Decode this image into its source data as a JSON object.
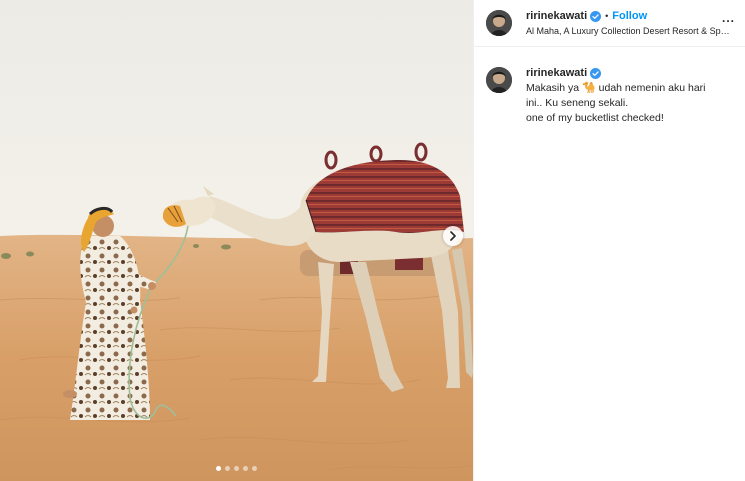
{
  "header": {
    "username": "ririnekawati",
    "separator": "•",
    "follow_label": "Follow",
    "location": "Al Maha, A Luxury Collection Desert Resort & Spa, Dubai",
    "more_label": "..."
  },
  "caption": {
    "username": "ririnekawati",
    "line1_pre": "Makasih ya",
    "line1_emoji": "🐪",
    "line1_post": "udah nemenin aku hari",
    "line2": "ini.. Ku seneng sekali.",
    "line3": "one of my bucketlist checked!"
  },
  "carousel": {
    "total": 5,
    "active_index": 0
  },
  "colors": {
    "link_blue": "#0095f6",
    "verified_blue": "#3897f0",
    "sand": "#d9a36a",
    "sky": "#f1efea"
  },
  "icons": {
    "verified": "verified-badge-icon",
    "next": "chevron-right-icon",
    "more": "more-options-icon"
  }
}
